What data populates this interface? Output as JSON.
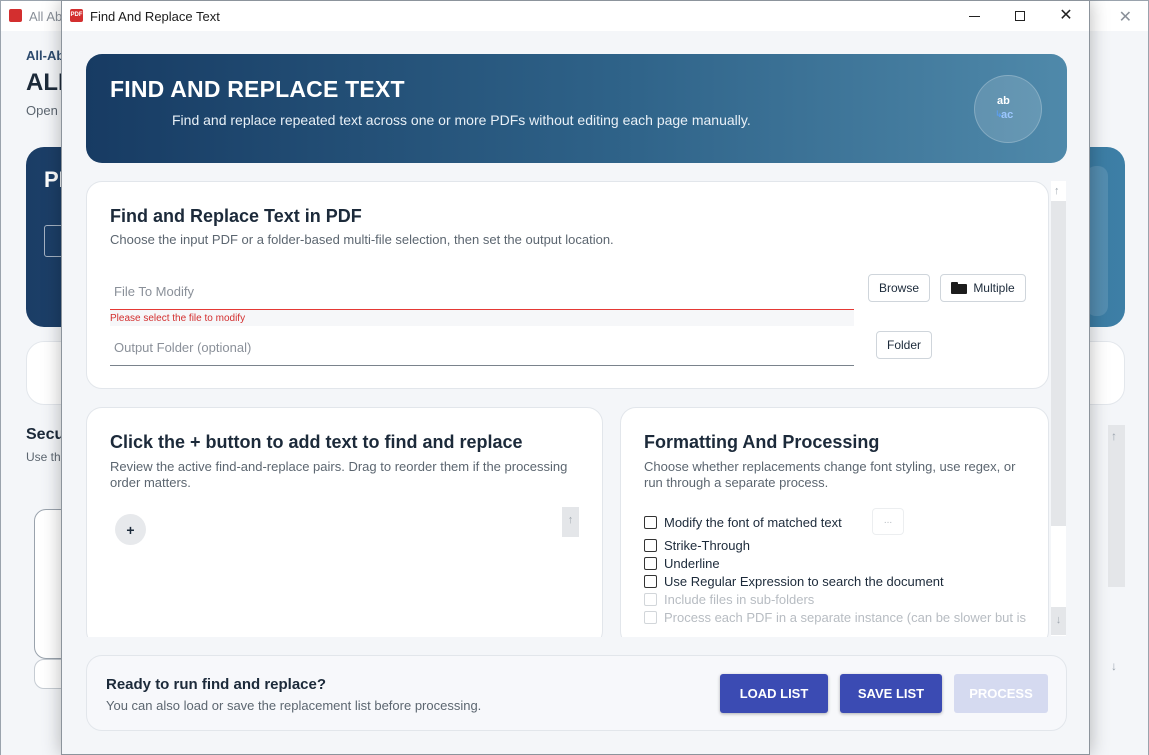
{
  "background_window": {
    "title": "All Ab",
    "crumb": "All-Ab",
    "heading": "ALL",
    "subtitle": "Open a",
    "hero_text": "PI",
    "section_title": "Secu",
    "section_sub": "Use th"
  },
  "dialog": {
    "title": "Find And Replace Text",
    "app_icon": "pdf-app-icon"
  },
  "banner": {
    "title": "FIND AND REPLACE TEXT",
    "subtitle": "Find and replace repeated text across one or more PDFs without editing each page manually.",
    "badge_top": "ab",
    "badge_bottom": "ac"
  },
  "file_section": {
    "title": "Find and Replace Text in PDF",
    "description": "Choose the input PDF or a folder-based multi-file selection, then set the output location.",
    "file_placeholder": "File To Modify",
    "file_value": "",
    "file_error": "Please select the file to modify",
    "output_placeholder": "Output Folder (optional)",
    "output_value": "",
    "browse_label": "Browse",
    "multiple_label": "Multiple",
    "folder_label": "Folder"
  },
  "list_section": {
    "title": "Click the + button to add text to find and replace",
    "description": "Review the active find-and-replace pairs. Drag to reorder them if the processing order matters.",
    "add_label": "+"
  },
  "format_section": {
    "title": "Formatting And Processing",
    "description": "Choose whether replacements change font styling, use regex, or run through a separate process.",
    "options": [
      {
        "label": "Modify the font of matched text",
        "checked": false,
        "enabled": true
      },
      {
        "label": "Strike-Through",
        "checked": false,
        "enabled": true
      },
      {
        "label": "Underline",
        "checked": false,
        "enabled": true
      },
      {
        "label": "Use Regular Expression to search the document",
        "checked": false,
        "enabled": true
      },
      {
        "label": "Include files in sub-folders",
        "checked": false,
        "enabled": false
      },
      {
        "label": "Process each PDF in a separate instance (can be slower but is",
        "checked": false,
        "enabled": false
      }
    ],
    "font_button_label": "..."
  },
  "footer": {
    "title": "Ready to run find and replace?",
    "description": "You can also load or save the replacement list before processing.",
    "load_label": "LOAD LIST",
    "save_label": "SAVE LIST",
    "process_label": "PROCESS"
  },
  "colors": {
    "accent": "#3b4bb3",
    "banner_start": "#173b63",
    "banner_end": "#4f89aa",
    "error": "#d32f2f",
    "app_icon": "#d32f2f"
  }
}
